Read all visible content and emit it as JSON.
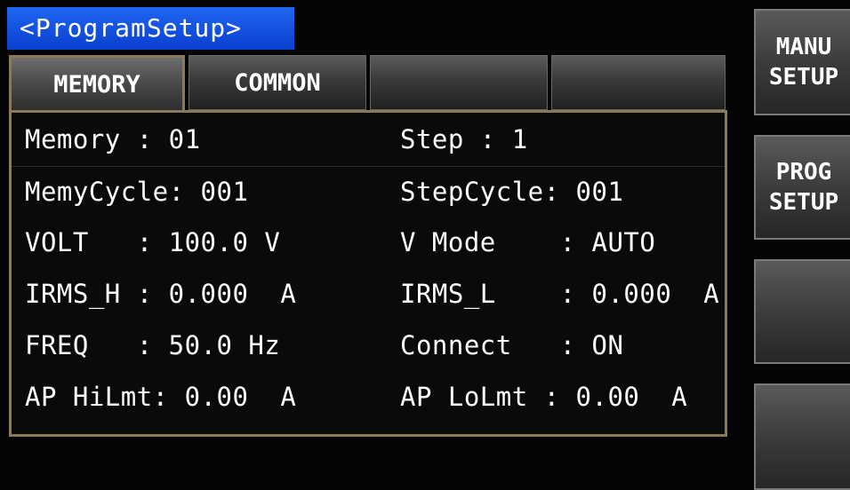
{
  "title": "<ProgramSetup>",
  "tabs": [
    "MEMORY",
    "COMMON",
    "",
    ""
  ],
  "fields": {
    "memory": "Memory : 01",
    "step": "Step : 1",
    "memy_cycle": "MemyCycle: 001",
    "step_cycle": "StepCycle: 001",
    "volt": "VOLT   : 100.0 V",
    "v_mode": "V Mode    : AUTO",
    "irms_h": "IRMS_H : 0.000  A",
    "irms_l": "IRMS_L    : 0.000  A",
    "freq": "FREQ   : 50.0 Hz",
    "connect": "Connect   : ON",
    "ap_hilmt": "AP HiLmt: 0.00  A",
    "ap_lolmt": "AP LoLmt : 0.00  A"
  },
  "side_buttons": {
    "manu_setup": {
      "line1": "MANU",
      "line2": "SETUP"
    },
    "prog_setup": {
      "line1": "PROG",
      "line2": "SETUP"
    }
  },
  "colors": {
    "title_bg": "#1552e6",
    "panel_border": "#8b7a5a",
    "background": "#050505"
  }
}
